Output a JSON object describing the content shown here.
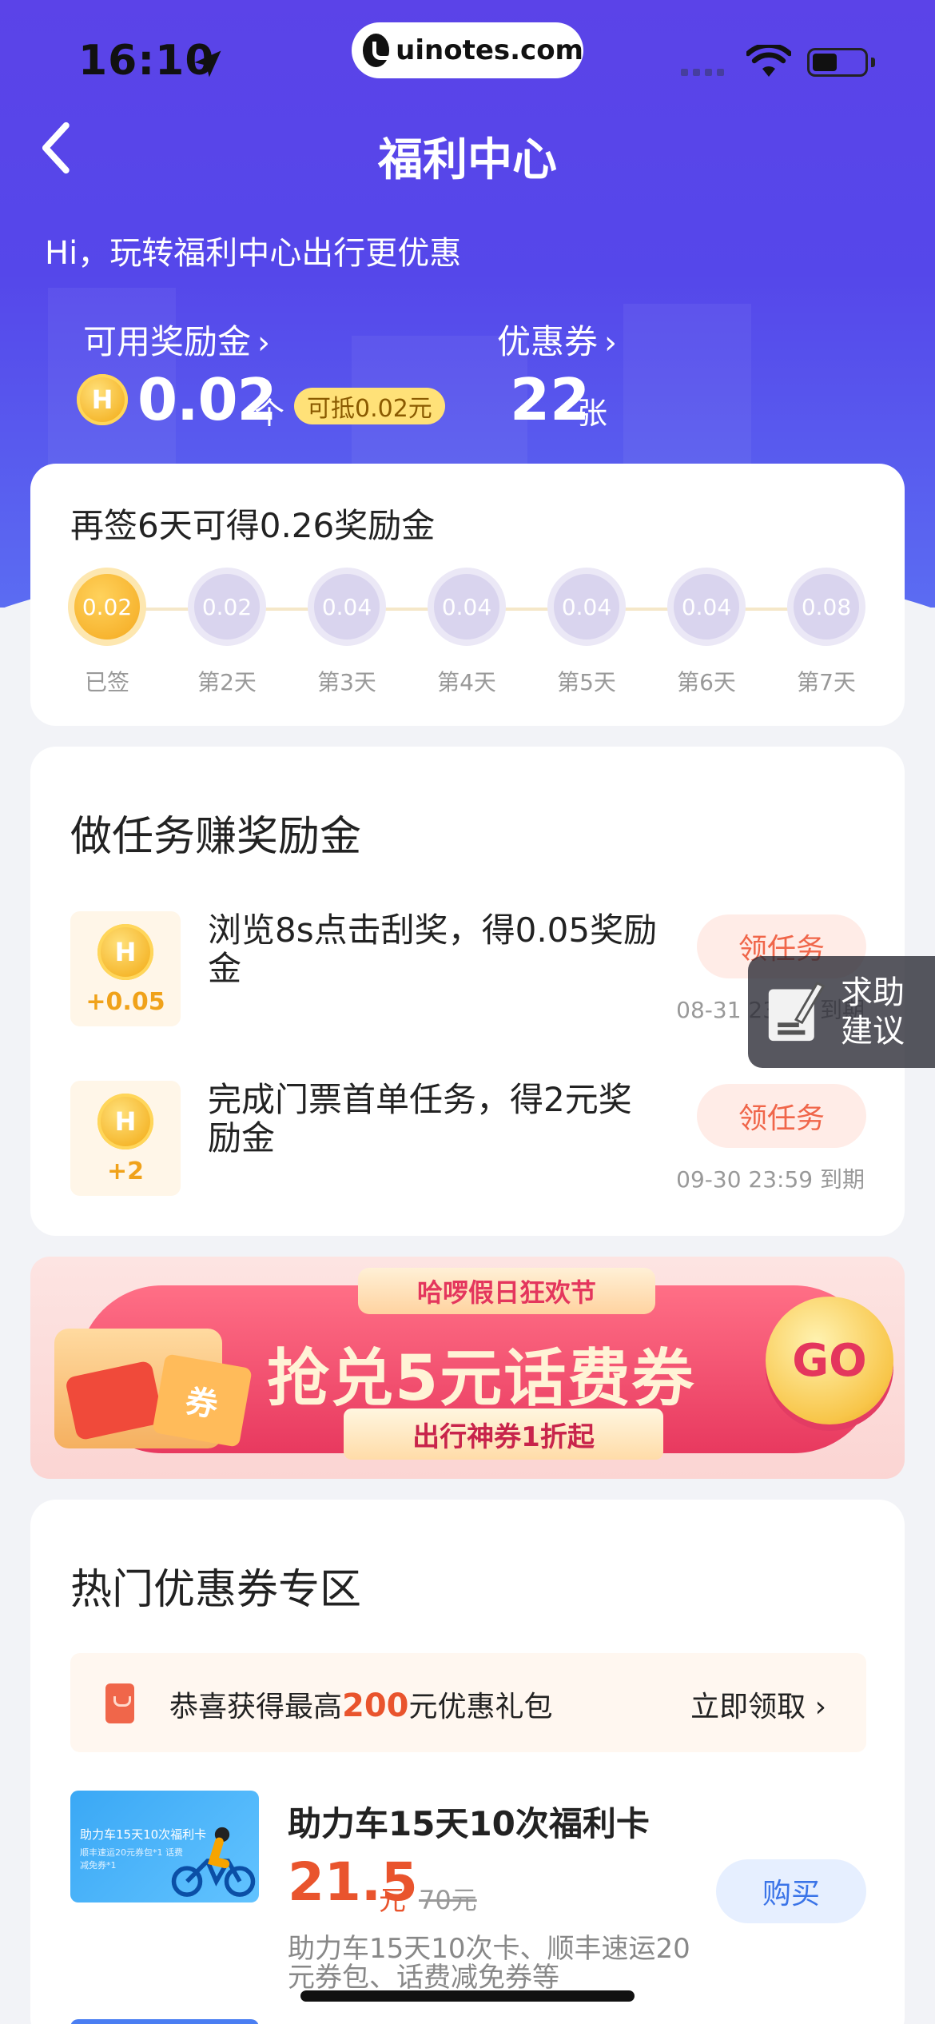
{
  "status_bar": {
    "time": "16:10",
    "url_pill": "uinotes.com"
  },
  "header": {
    "title": "福利中心"
  },
  "greeting": "Hi，玩转福利中心出行更优惠",
  "rewards": {
    "reward_label": "可用奖励金",
    "reward_value": "0.02",
    "reward_unit": "个",
    "deduct_badge": "可抵0.02元",
    "coupon_label": "优惠券",
    "coupon_value": "22",
    "coupon_unit": "张",
    "coin_glyph": "H",
    "chevron": "›"
  },
  "signin": {
    "title": "再签6天可得0.26奖励金",
    "days": [
      {
        "amount": "0.02",
        "label": "已签",
        "done": true
      },
      {
        "amount": "0.02",
        "label": "第2天",
        "done": false
      },
      {
        "amount": "0.04",
        "label": "第3天",
        "done": false
      },
      {
        "amount": "0.04",
        "label": "第4天",
        "done": false
      },
      {
        "amount": "0.04",
        "label": "第5天",
        "done": false
      },
      {
        "amount": "0.04",
        "label": "第6天",
        "done": false
      },
      {
        "amount": "0.08",
        "label": "第7天",
        "done": false
      }
    ]
  },
  "tasks": {
    "title": "做任务赚奖励金",
    "items": [
      {
        "amount": "+0.05",
        "text": "浏览8s点击刮奖，得0.05奖励金",
        "button": "领任务",
        "deadline": "08-31 23:59 到期"
      },
      {
        "amount": "+2",
        "text": "完成门票首单任务，得2元奖励金",
        "button": "领任务",
        "deadline": "09-30 23:59 到期"
      }
    ]
  },
  "floating_help": {
    "line1": "求助",
    "line2": "建议"
  },
  "banner": {
    "tag": "哈啰假日狂欢节",
    "main": "抢兑5元话费券",
    "sub": "出行神券1折起",
    "go": "GO",
    "ticket": "券"
  },
  "coupons": {
    "title": "热门优惠券专区",
    "promo_prefix": "恭喜获得最高",
    "promo_amount": "200",
    "promo_suffix": "元优惠礼包",
    "promo_link": "立即领取 ›",
    "product": {
      "image_title": "助力车15天10次福利卡",
      "image_sub": "顺丰速运20元券包*1 话费减免券*1",
      "name": "助力车15天10次福利卡",
      "price": "21.5",
      "price_unit": "元",
      "original_price": "70元",
      "desc": "助力车15天10次卡、顺丰速运20元券包、话费减免券等",
      "button": "购买"
    }
  },
  "colors": {
    "hero": "#5547ea",
    "accent_orange": "#e9542d",
    "coin_gold": "#f5b62b",
    "buy_blue": "#3b74e8"
  }
}
